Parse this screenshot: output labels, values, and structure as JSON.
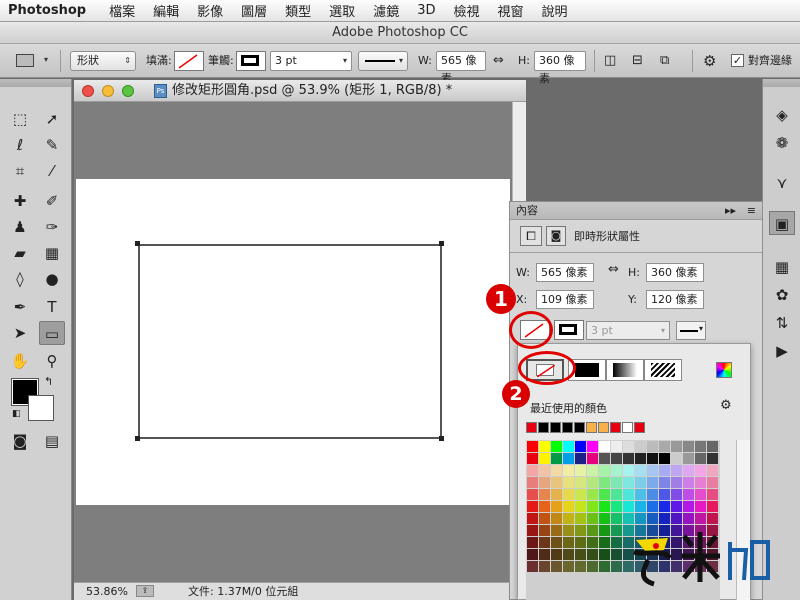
{
  "menubar": {
    "app": "Photoshop",
    "items": [
      "檔案",
      "編輯",
      "影像",
      "圖層",
      "類型",
      "選取",
      "濾鏡",
      "3D",
      "檢視",
      "視窗",
      "說明"
    ]
  },
  "app_title": "Adobe Photoshop CC",
  "options": {
    "mode": "形狀",
    "fill_label": "填滿:",
    "stroke_label": "筆觸:",
    "stroke_width": "3 pt",
    "w_label": "W:",
    "w_value": "565 像素",
    "h_label": "H:",
    "h_value": "360 像素",
    "align_edges": "對齊邊緣"
  },
  "document": {
    "title": "修改矩形圓角.psd @ 53.9% (矩形 1, RGB/8) *",
    "zoom": "53.86%",
    "file_info": "文件: 1.37M/0 位元組"
  },
  "properties": {
    "tab": "內容",
    "section": "即時形狀屬性",
    "w_label": "W:",
    "w_value": "565 像素",
    "h_label": "H:",
    "h_value": "360 像素",
    "x_label": "X:",
    "x_value": "109 像素",
    "y_label": "Y:",
    "y_value": "120 像素",
    "stroke_width": "3 pt"
  },
  "swatch_popup": {
    "recent_label": "最近使用的顏色",
    "recent_colors": [
      "#e60012",
      "#000000",
      "#000000",
      "#000000",
      "#000000",
      "#f7b04a",
      "#f7b04a",
      "#e60012",
      "#ffffff",
      "#e60012"
    ]
  },
  "callouts": [
    "1",
    "2"
  ],
  "watermark": "奧米加",
  "colors": {
    "annotation_red": "#e10000",
    "panel_gray": "#d1d1d1",
    "canvas_bg": "#7e7e7e"
  }
}
